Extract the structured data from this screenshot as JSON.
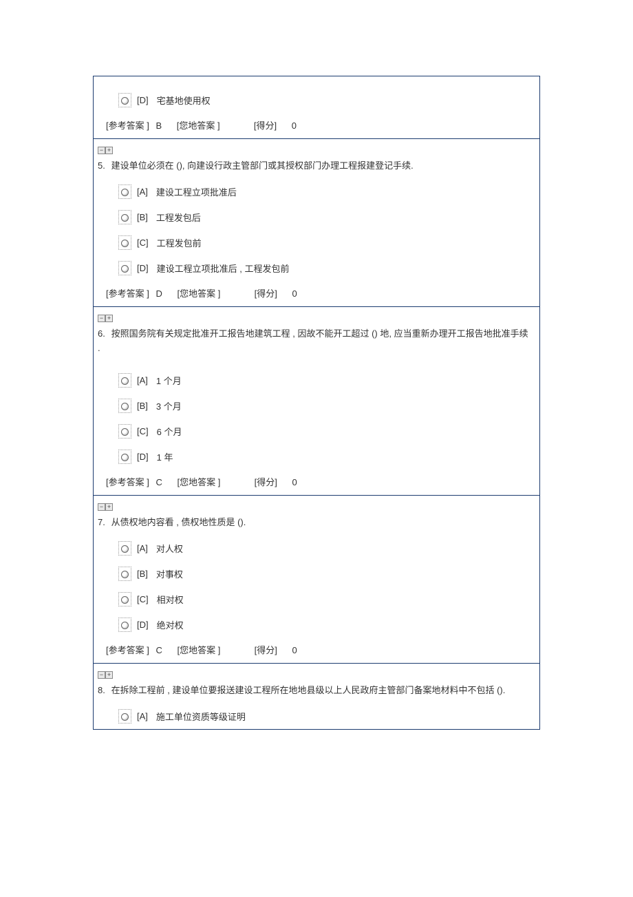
{
  "toggle_minus": "−",
  "toggle_plus": "+",
  "labels": {
    "ref_answer": "[参考答案 ]",
    "your_answer": "[您地答案 ]",
    "score": "[得分]"
  },
  "q4_partial": {
    "options": [
      {
        "letter": "[D]",
        "text": "宅基地使用权"
      }
    ],
    "ref_answer": "B",
    "your_answer": "",
    "score": "0"
  },
  "questions": [
    {
      "num": "5.",
      "text": "建设单位必须在  (),  向建设行政主管部门或其授权部门办理工程报建登记手续.",
      "options": [
        {
          "letter": "[A]",
          "text": "建设工程立项批准后"
        },
        {
          "letter": "[B]",
          "text": "工程发包后"
        },
        {
          "letter": "[C]",
          "text": "工程发包前"
        },
        {
          "letter": "[D]",
          "text": "建设工程立项批准后 , 工程发包前"
        }
      ],
      "ref_answer": "D",
      "your_answer": "",
      "score": "0"
    },
    {
      "num": "6.",
      "text": "按照国务院有关规定批准开工报告地建筑工程 , 因故不能开工超过 () 地, 应当重新办理开工报告地批准手续 .",
      "options": [
        {
          "letter": "[A]",
          "text": "1 个月"
        },
        {
          "letter": "[B]",
          "text": "3 个月"
        },
        {
          "letter": "[C]",
          "text": "6 个月"
        },
        {
          "letter": "[D]",
          "text": "1 年"
        }
      ],
      "ref_answer": "C",
      "your_answer": "",
      "score": "0"
    },
    {
      "num": "7.",
      "text": "从债权地内容看  , 债权地性质是  ().",
      "options": [
        {
          "letter": "[A]",
          "text": "对人权"
        },
        {
          "letter": "[B]",
          "text": "对事权"
        },
        {
          "letter": "[C]",
          "text": "相对权"
        },
        {
          "letter": "[D]",
          "text": "绝对权"
        }
      ],
      "ref_answer": "C",
      "your_answer": "",
      "score": "0"
    },
    {
      "num": "8.",
      "text": "在拆除工程前  , 建设单位要报送建设工程所在地地县级以上人民政府主管部门备案地材料中不包括            ().",
      "options": [
        {
          "letter": "[A]",
          "text": "施工单位资质等级证明"
        }
      ],
      "ref_answer": null,
      "your_answer": null,
      "score": null,
      "partial": true
    }
  ]
}
